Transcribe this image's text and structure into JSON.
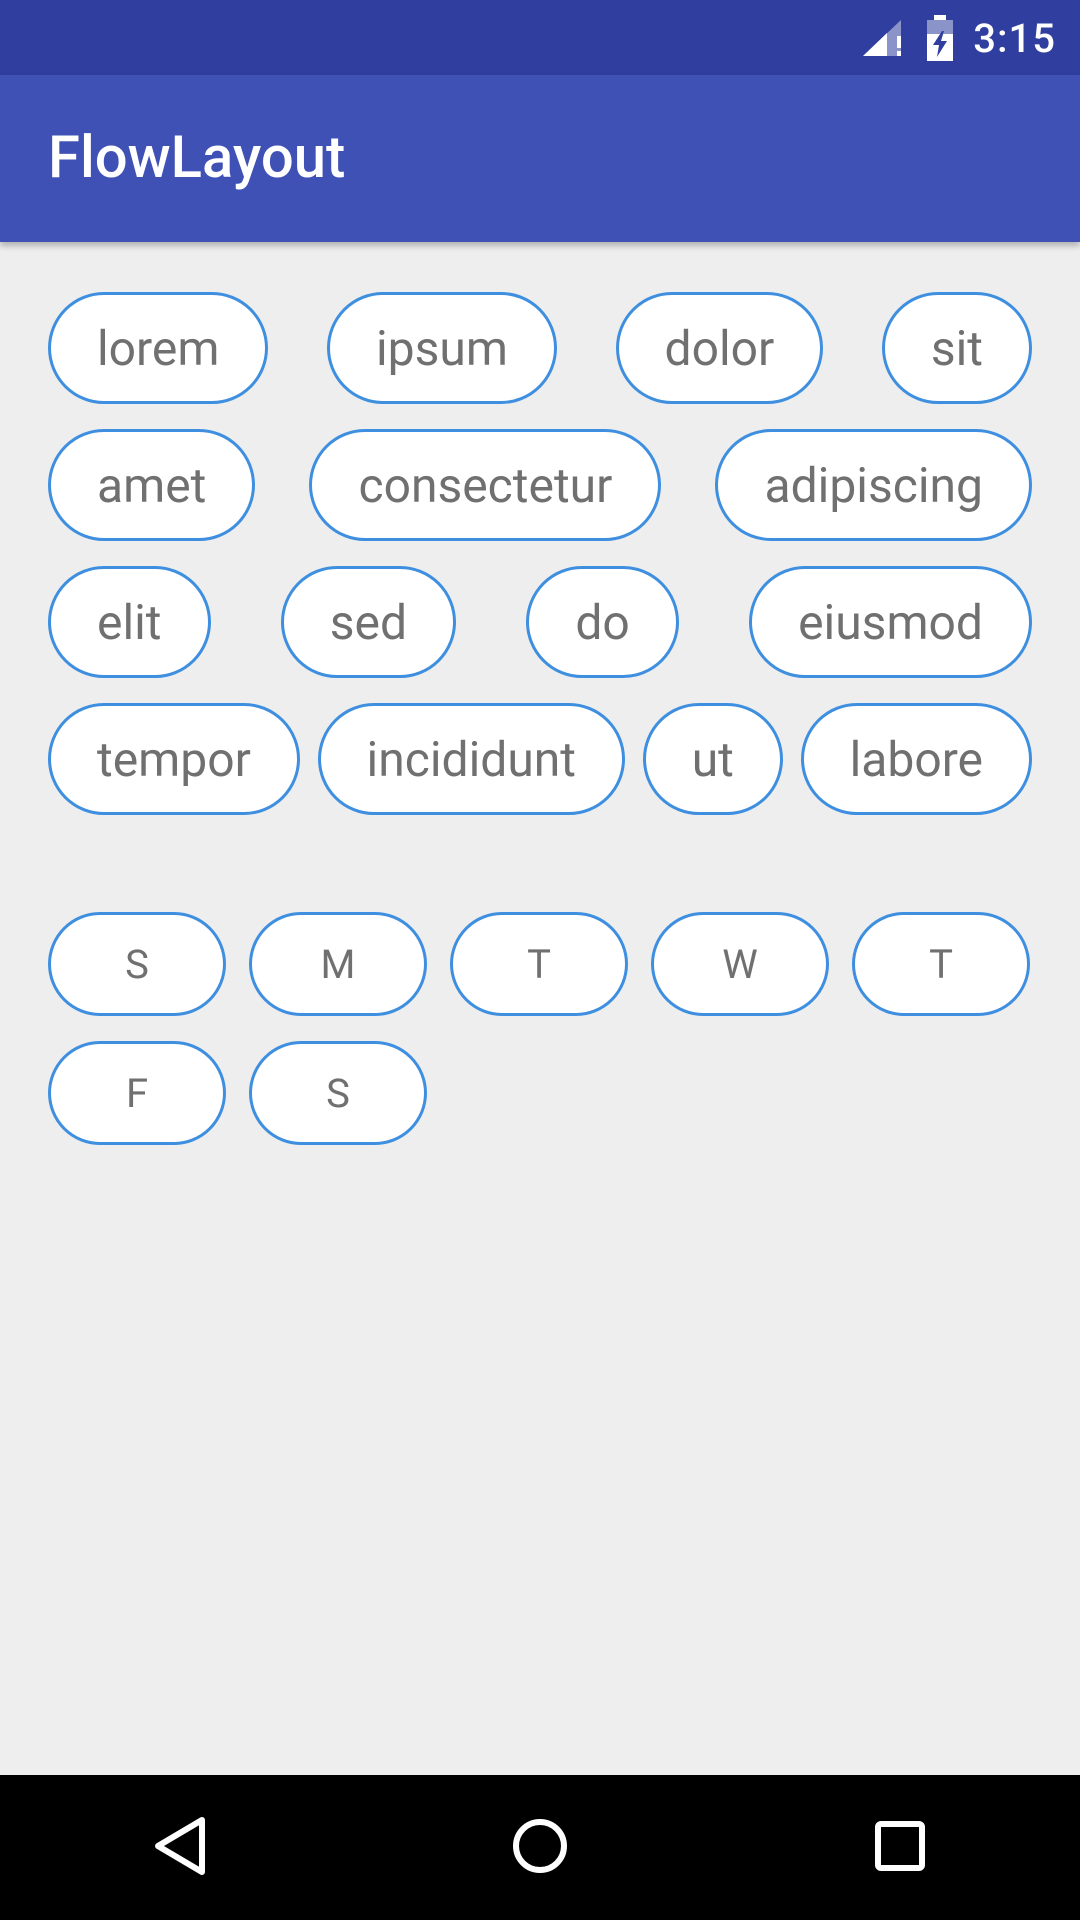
{
  "status_bar": {
    "time": "3:15",
    "icons": [
      "signal-icon",
      "battery-charging-icon"
    ]
  },
  "app_bar": {
    "title": "FlowLayout"
  },
  "flow_tags": {
    "rows": [
      [
        "lorem",
        "ipsum",
        "dolor",
        "sit"
      ],
      [
        "amet",
        "consectetur",
        "adipiscing"
      ],
      [
        "elit",
        "sed",
        "do",
        "eiusmod"
      ],
      [
        "tempor",
        "incididunt",
        "ut",
        "labore"
      ]
    ]
  },
  "days": {
    "rows": [
      [
        "S",
        "M",
        "T",
        "W",
        "T"
      ],
      [
        "F",
        "S"
      ]
    ]
  },
  "nav_bar": {
    "icons": [
      "back-icon",
      "home-icon",
      "recents-icon"
    ]
  },
  "colors": {
    "status_bar": "#303f9f",
    "app_bar": "#3f51b5",
    "tag_border": "#3f8fe0",
    "background": "#eeeeee"
  }
}
